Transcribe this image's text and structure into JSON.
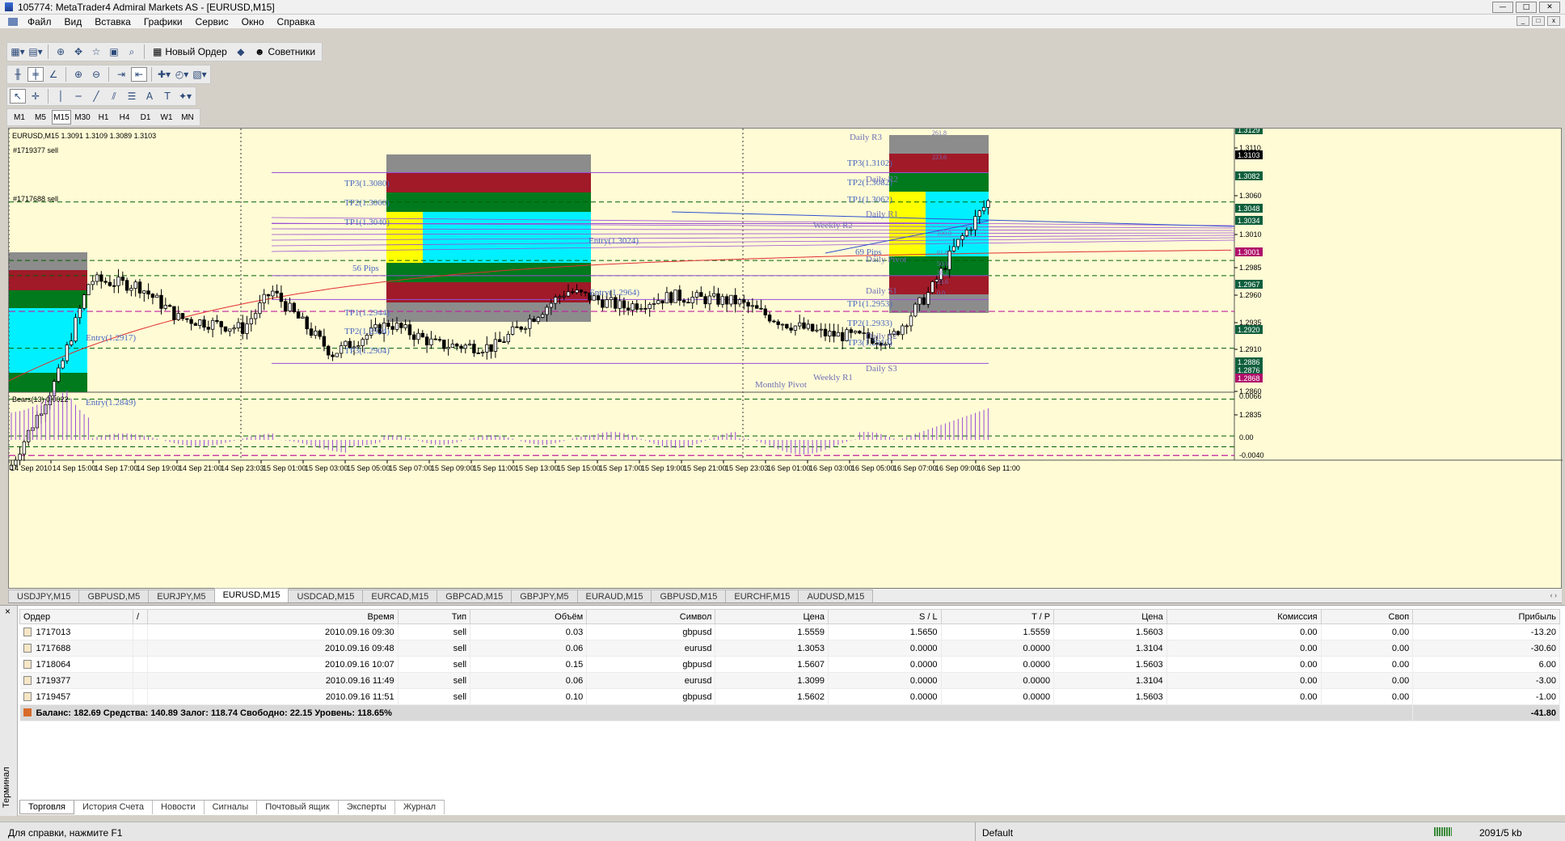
{
  "window": {
    "title": "105774: MetaTrader4 Admiral Markets AS - [EURUSD,M15]",
    "buttons": [
      "—",
      "□",
      "✕"
    ]
  },
  "menu": {
    "items": [
      "Файл",
      "Вид",
      "Вставка",
      "Графики",
      "Сервис",
      "Окно",
      "Справка"
    ],
    "mdi_buttons": [
      "_",
      "□",
      "x"
    ]
  },
  "toolbar": {
    "new_order": "Новый Ордер",
    "experts": "Советники",
    "timeframes": [
      "M1",
      "M5",
      "M15",
      "M30",
      "H1",
      "H4",
      "D1",
      "W1",
      "MN"
    ],
    "active_timeframe": "M15"
  },
  "chart": {
    "header": "EURUSD,M15 1.3091 1.3109 1.3089 1.3103",
    "indicator_label": "Bears(13) 0.0022",
    "order_labels": [
      {
        "text": "#1719377 sell"
      },
      {
        "text": "#1717688 sell"
      }
    ],
    "price_axis": [
      {
        "value": "1.3110"
      },
      {
        "value": "1.3060"
      },
      {
        "value": "1.3010"
      },
      {
        "value": "1.2985"
      },
      {
        "value": "1.2960"
      },
      {
        "value": "1.2935"
      },
      {
        "value": "1.2910"
      },
      {
        "value": "1.2860"
      },
      {
        "value": "1.2835"
      }
    ],
    "price_tags": [
      {
        "value": "1.3129",
        "color": "#0f5f3c"
      },
      {
        "value": "1.3103",
        "color": "#000000"
      },
      {
        "value": "1.3082",
        "color": "#0f5f3c"
      },
      {
        "value": "1.3048",
        "color": "#0f5f3c"
      },
      {
        "value": "1.3034",
        "color": "#0f5f3c"
      },
      {
        "value": "1.3001",
        "color": "#b0106a"
      },
      {
        "value": "1.2967",
        "color": "#0f5f3c"
      },
      {
        "value": "1.2920",
        "color": "#0f5f3c"
      },
      {
        "value": "1.2886",
        "color": "#0f5f3c"
      },
      {
        "value": "1.2876",
        "color": "#0f5f3c"
      },
      {
        "value": "1.2868",
        "color": "#b0106a"
      }
    ],
    "indicator_axis": [
      {
        "value": "0.0066"
      },
      {
        "value": "0.00"
      },
      {
        "value": "-0.0040"
      }
    ],
    "time_axis": [
      "14 Sep 2010",
      "14 Sep 15:00",
      "14 Sep 17:00",
      "14 Sep 19:00",
      "14 Sep 21:00",
      "14 Sep 23:03",
      "15 Sep 01:00",
      "15 Sep 03:00",
      "15 Sep 05:00",
      "15 Sep 07:00",
      "15 Sep 09:00",
      "15 Sep 11:00",
      "15 Sep 13:00",
      "15 Sep 15:00",
      "15 Sep 17:00",
      "15 Sep 19:00",
      "15 Sep 21:00",
      "15 Sep 23:03",
      "16 Sep 01:00",
      "16 Sep 03:00",
      "16 Sep 05:00",
      "16 Sep 07:00",
      "16 Sep 09:00",
      "16 Sep 11:00"
    ],
    "level_labels": [
      {
        "text": "Daily R3",
        "color": "#7070b8"
      },
      {
        "text": "261.8",
        "color": "#7070b8"
      },
      {
        "text": "TP3(1.3102)",
        "color": "#4a68c0"
      },
      {
        "text": "223.6",
        "color": "#7070b8"
      },
      {
        "text": "TP2(1.3082)",
        "color": "#4a68c0"
      },
      {
        "text": "Daily R2",
        "color": "#7070b8"
      },
      {
        "text": "TP1(1.3062)",
        "color": "#4a68c0"
      },
      {
        "text": "Daily R1",
        "color": "#7070b8"
      },
      {
        "text": "Weekly R2",
        "color": "#7070b8"
      },
      {
        "text": "TP3(1.3080)",
        "color": "#4a68c0"
      },
      {
        "text": "TP2(1.3060)",
        "color": "#4a68c0"
      },
      {
        "text": "TP1(1.3040)",
        "color": "#4a68c0"
      },
      {
        "text": "Entry(1.3024)",
        "color": "#4a68c0"
      },
      {
        "text": "56 Pips",
        "color": "#4a68c0"
      },
      {
        "text": "Entry(1.2964)",
        "color": "#4a68c0"
      },
      {
        "text": "TP1(1.2944)",
        "color": "#4a68c0"
      },
      {
        "text": "TP2(1.2924)",
        "color": "#4a68c0"
      },
      {
        "text": "TP3(1.2904)",
        "color": "#4a68c0"
      },
      {
        "text": "69 Pips",
        "color": "#4a68c0"
      },
      {
        "text": "Daily Pivot",
        "color": "#7070b8"
      },
      {
        "text": "Daily S1",
        "color": "#7070b8"
      },
      {
        "text": "TP1(1.2953)",
        "color": "#4a68c0"
      },
      {
        "text": "TP2(1.2933)",
        "color": "#4a68c0"
      },
      {
        "text": "Daily S2",
        "color": "#7070b8"
      },
      {
        "text": "TP3(1.2913)",
        "color": "#4a68c0"
      },
      {
        "text": "Daily S3",
        "color": "#7070b8"
      },
      {
        "text": "Weekly R1",
        "color": "#7070b8"
      },
      {
        "text": "Monthly Pivot",
        "color": "#7070b8"
      },
      {
        "text": "Entry(1.2917)",
        "color": "#4a68c0"
      },
      {
        "text": "Entry(1.2849)",
        "color": "#4a68c0"
      },
      {
        "text": "100.0",
        "color": "#7070b8"
      },
      {
        "text": "61.8",
        "color": "#7070b8"
      },
      {
        "text": "50.0",
        "color": "#7070b8"
      },
      {
        "text": "38.2",
        "color": "#7070b8"
      },
      {
        "text": "23.6",
        "color": "#7070b8"
      },
      {
        "text": "0.0",
        "color": "#7070b8"
      }
    ],
    "colors": {
      "background": "#fffbd5",
      "cyan": "#00f0ff",
      "yellow": "#ffff00",
      "green": "#007a1c",
      "darkred": "#a01a28",
      "gray": "#8c8c8c",
      "ma": "#e03030",
      "histogram": "#9a4fd6"
    }
  },
  "symbol_tabs": [
    "USDJPY,M15",
    "GBPUSD,M5",
    "EURJPY,M5",
    "EURUSD,M15",
    "USDCAD,M15",
    "EURCAD,M15",
    "GBPCAD,M15",
    "GBPJPY,M5",
    "EURAUD,M15",
    "GBPUSD,M15",
    "EURCHF,M15",
    "AUDUSD,M15"
  ],
  "active_symbol_tab": "EURUSD,M15",
  "symbol_tab_nav": "‹ ›",
  "terminal": {
    "close": "×",
    "side_label": "Терминал",
    "columns": [
      "Ордер",
      "/",
      "Время",
      "Тип",
      "Объём",
      "Символ",
      "Цена",
      "S / L",
      "T / P",
      "Цена",
      "Комиссия",
      "Своп",
      "Прибыль"
    ],
    "rows": [
      {
        "order": "1717013",
        "time": "2010.09.16 09:30",
        "type": "sell",
        "volume": "0.03",
        "symbol": "gbpusd",
        "price": "1.5559",
        "sl": "1.5650",
        "tp": "1.5559",
        "cur": "1.5603",
        "commission": "0.00",
        "swap": "0.00",
        "profit": "-13.20"
      },
      {
        "order": "1717688",
        "time": "2010.09.16 09:48",
        "type": "sell",
        "volume": "0.06",
        "symbol": "eurusd",
        "price": "1.3053",
        "sl": "0.0000",
        "tp": "0.0000",
        "cur": "1.3104",
        "commission": "0.00",
        "swap": "0.00",
        "profit": "-30.60"
      },
      {
        "order": "1718064",
        "time": "2010.09.16 10:07",
        "type": "sell",
        "volume": "0.15",
        "symbol": "gbpusd",
        "price": "1.5607",
        "sl": "0.0000",
        "tp": "0.0000",
        "cur": "1.5603",
        "commission": "0.00",
        "swap": "0.00",
        "profit": "6.00"
      },
      {
        "order": "1719377",
        "time": "2010.09.16 11:49",
        "type": "sell",
        "volume": "0.06",
        "symbol": "eurusd",
        "price": "1.3099",
        "sl": "0.0000",
        "tp": "0.0000",
        "cur": "1.3104",
        "commission": "0.00",
        "swap": "0.00",
        "profit": "-3.00"
      },
      {
        "order": "1719457",
        "time": "2010.09.16 11:51",
        "type": "sell",
        "volume": "0.10",
        "symbol": "gbpusd",
        "price": "1.5602",
        "sl": "0.0000",
        "tp": "0.0000",
        "cur": "1.5603",
        "commission": "0.00",
        "swap": "0.00",
        "profit": "-1.00"
      }
    ],
    "summary": {
      "text": "Баланс: 182.69  Средства: 140.89  Залог: 118.74  Свободно: 22.15  Уровень: 118.65%",
      "profit": "-41.80"
    },
    "tabs": [
      "Торговля",
      "История Счета",
      "Новости",
      "Сигналы",
      "Почтовый ящик",
      "Эксперты",
      "Журнал"
    ]
  },
  "status": {
    "help": "Для справки, нажмите F1",
    "profile": "Default",
    "traffic": "2091/5 kb"
  }
}
